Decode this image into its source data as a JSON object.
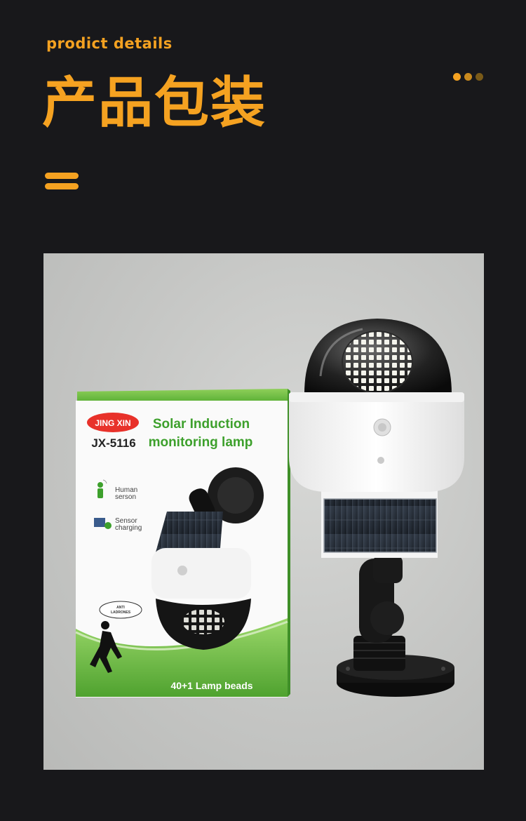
{
  "header": {
    "subtitle": "prodict details",
    "title": "产品包装"
  },
  "colors": {
    "accent": "#f5a221",
    "background": "#18181b",
    "dots": [
      "#f5a221",
      "#c98a1e",
      "#7a5a18"
    ]
  },
  "icons": {
    "dots": "three-dots-icon",
    "menu": "menu-icon"
  },
  "photo": {
    "box": {
      "brand": "JING XIN",
      "model": "JX-5116",
      "product_name_line1": "Solar  Induction",
      "product_name_line2": "monitoring  lamp",
      "feature1_line1": "Human",
      "feature1_line2": "serson",
      "feature2_line1": "Sensor",
      "feature2_line2": "charging",
      "bubble_line1": "ANTI",
      "bubble_line2": "LADRONES",
      "beads": "40+1 Lamp beads"
    }
  }
}
